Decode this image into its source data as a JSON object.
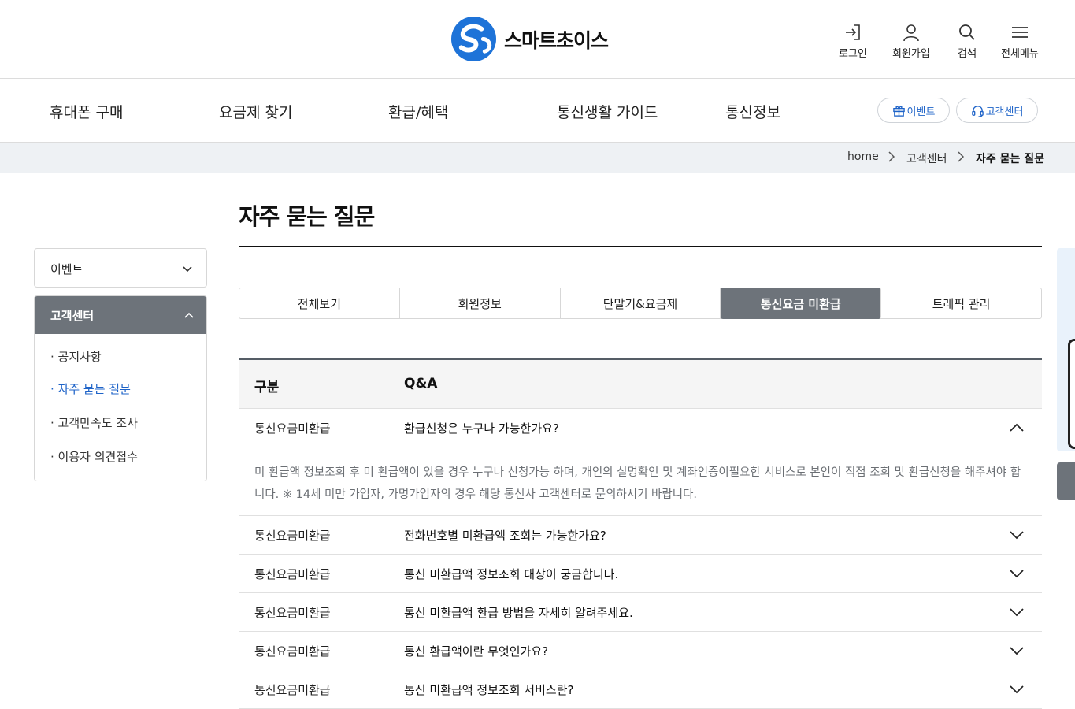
{
  "header": {
    "brand": "스마트초이스",
    "util": [
      {
        "label": "로그인",
        "icon": "login-icon"
      },
      {
        "label": "회원가입",
        "icon": "user-icon"
      },
      {
        "label": "검색",
        "icon": "search-icon"
      },
      {
        "label": "전체메뉴",
        "icon": "menu-icon"
      }
    ]
  },
  "gnb": {
    "items": [
      "휴대폰 구매",
      "요금제 찾기",
      "환급/혜택",
      "통신생활 가이드",
      "통신정보"
    ],
    "event_label": "이벤트",
    "support_label": "고객센터",
    "accent_color": "#1e63c8"
  },
  "breadcrumb": [
    "home",
    "고객센터",
    "자주 묻는 질문"
  ],
  "page": {
    "title": "자주 묻는 질문"
  },
  "sidebar": {
    "event": "이벤트",
    "support": "고객센터",
    "sub_items": [
      "· 공지사항",
      "· 자주 묻는 질문",
      "· 고객만족도 조사",
      "· 이용자 의견접수"
    ],
    "active_index": 1
  },
  "tabs": {
    "items": [
      "전체보기",
      "회원정보",
      "단말기&요금제",
      "통신요금 미환급",
      "트래픽 관리"
    ],
    "active_index": 3
  },
  "faq": {
    "col_category": "구분",
    "col_qa": "Q&A",
    "open_item": {
      "category": "통신요금미환급",
      "question": "환급신청은 누구나 가능한가요?",
      "answer": "미 환급액 정보조회 후 미 환급액이 있을 경우 누구나 신청가능 하며, 개인의 실명확인 및 계좌인증이필요한 서비스로 본인이 직접 조회 및 환급신청을 해주셔야 합니다. ※ 14세 미만 가입자, 가명가입자의 경우 해당 통신사 고객센터로 문의하시기 바랍니다."
    },
    "items": [
      {
        "category": "통신요금미환급",
        "question": "전화번호별 미환급액 조회는 가능한가요?"
      },
      {
        "category": "통신요금미환급",
        "question": "통신 미환급액 정보조회 대상이 궁금합니다."
      },
      {
        "category": "통신요금미환급",
        "question": "통신 미환급액 환급 방법을 자세히 알려주세요."
      },
      {
        "category": "통신요금미환급",
        "question": "통신 환급액이란 무엇인가요?"
      },
      {
        "category": "통신요금미환급",
        "question": "통신 미환급액 정보조회 서비스란?"
      }
    ]
  }
}
